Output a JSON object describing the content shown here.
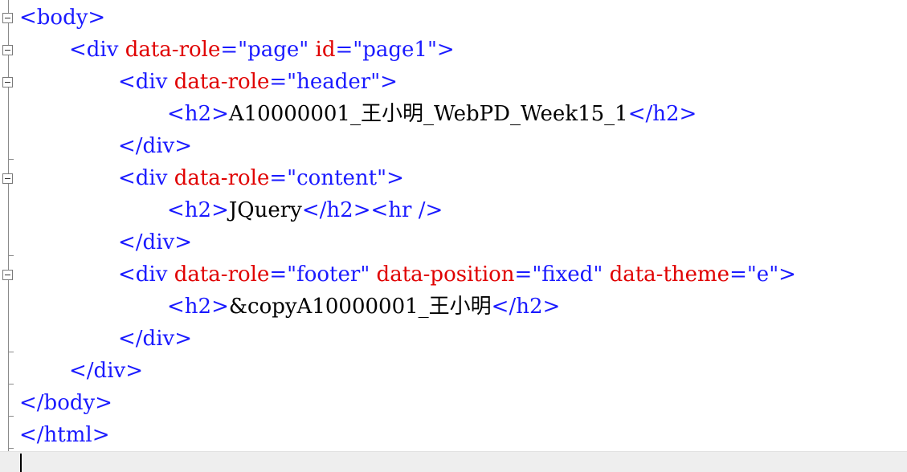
{
  "code_lines": [
    {
      "segments": [
        {
          "text": "<body>",
          "type": "tag"
        }
      ]
    },
    {
      "segments": [
        {
          "text": "<div ",
          "type": "tag"
        },
        {
          "text": "data-role",
          "type": "attr"
        },
        {
          "text": "=\"page\" ",
          "type": "value"
        },
        {
          "text": "id",
          "type": "attr"
        },
        {
          "text": "=\"page1\">",
          "type": "value"
        }
      ]
    },
    {
      "segments": [
        {
          "text": "<div ",
          "type": "tag"
        },
        {
          "text": "data-role",
          "type": "attr"
        },
        {
          "text": "=\"header\">",
          "type": "value"
        }
      ]
    },
    {
      "segments": [
        {
          "text": "<h2>",
          "type": "tag"
        },
        {
          "text": "A10000001_王小明_WebPD_Week15_1",
          "type": "text"
        },
        {
          "text": "</h2>",
          "type": "tag"
        }
      ]
    },
    {
      "segments": [
        {
          "text": "</div>",
          "type": "tag"
        }
      ]
    },
    {
      "segments": [
        {
          "text": "<div ",
          "type": "tag"
        },
        {
          "text": "data-role",
          "type": "attr"
        },
        {
          "text": "=\"content\">",
          "type": "value"
        }
      ]
    },
    {
      "segments": [
        {
          "text": "<h2>",
          "type": "tag"
        },
        {
          "text": "JQuery",
          "type": "text"
        },
        {
          "text": "</h2><hr />",
          "type": "tag"
        }
      ]
    },
    {
      "segments": [
        {
          "text": "</div>",
          "type": "tag"
        }
      ]
    },
    {
      "segments": [
        {
          "text": "<div ",
          "type": "tag"
        },
        {
          "text": "data-role",
          "type": "attr"
        },
        {
          "text": "=\"footer\" ",
          "type": "value"
        },
        {
          "text": "data-position",
          "type": "attr"
        },
        {
          "text": "=\"fixed\" ",
          "type": "value"
        },
        {
          "text": "data-theme",
          "type": "attr"
        },
        {
          "text": "=\"e\">",
          "type": "value"
        }
      ]
    },
    {
      "segments": [
        {
          "text": "<h2>",
          "type": "tag"
        },
        {
          "text": "&copyA10000001_王小明",
          "type": "text"
        },
        {
          "text": "</h2>",
          "type": "tag"
        }
      ]
    },
    {
      "segments": [
        {
          "text": "</div>",
          "type": "tag"
        }
      ]
    },
    {
      "segments": [
        {
          "text": "</div>",
          "type": "tag"
        }
      ]
    },
    {
      "segments": [
        {
          "text": "</body>",
          "type": "tag"
        }
      ]
    },
    {
      "segments": [
        {
          "text": "</html>",
          "type": "tag"
        }
      ]
    }
  ],
  "colors": {
    "tag": "#1a1aff",
    "attr": "#e00000",
    "value": "#1a1aff",
    "text": "#000000",
    "gutter_line": "#8a8a8a",
    "status_bar": "#eeeeee"
  },
  "icons": {
    "fold": "fold-toggle-icon"
  }
}
